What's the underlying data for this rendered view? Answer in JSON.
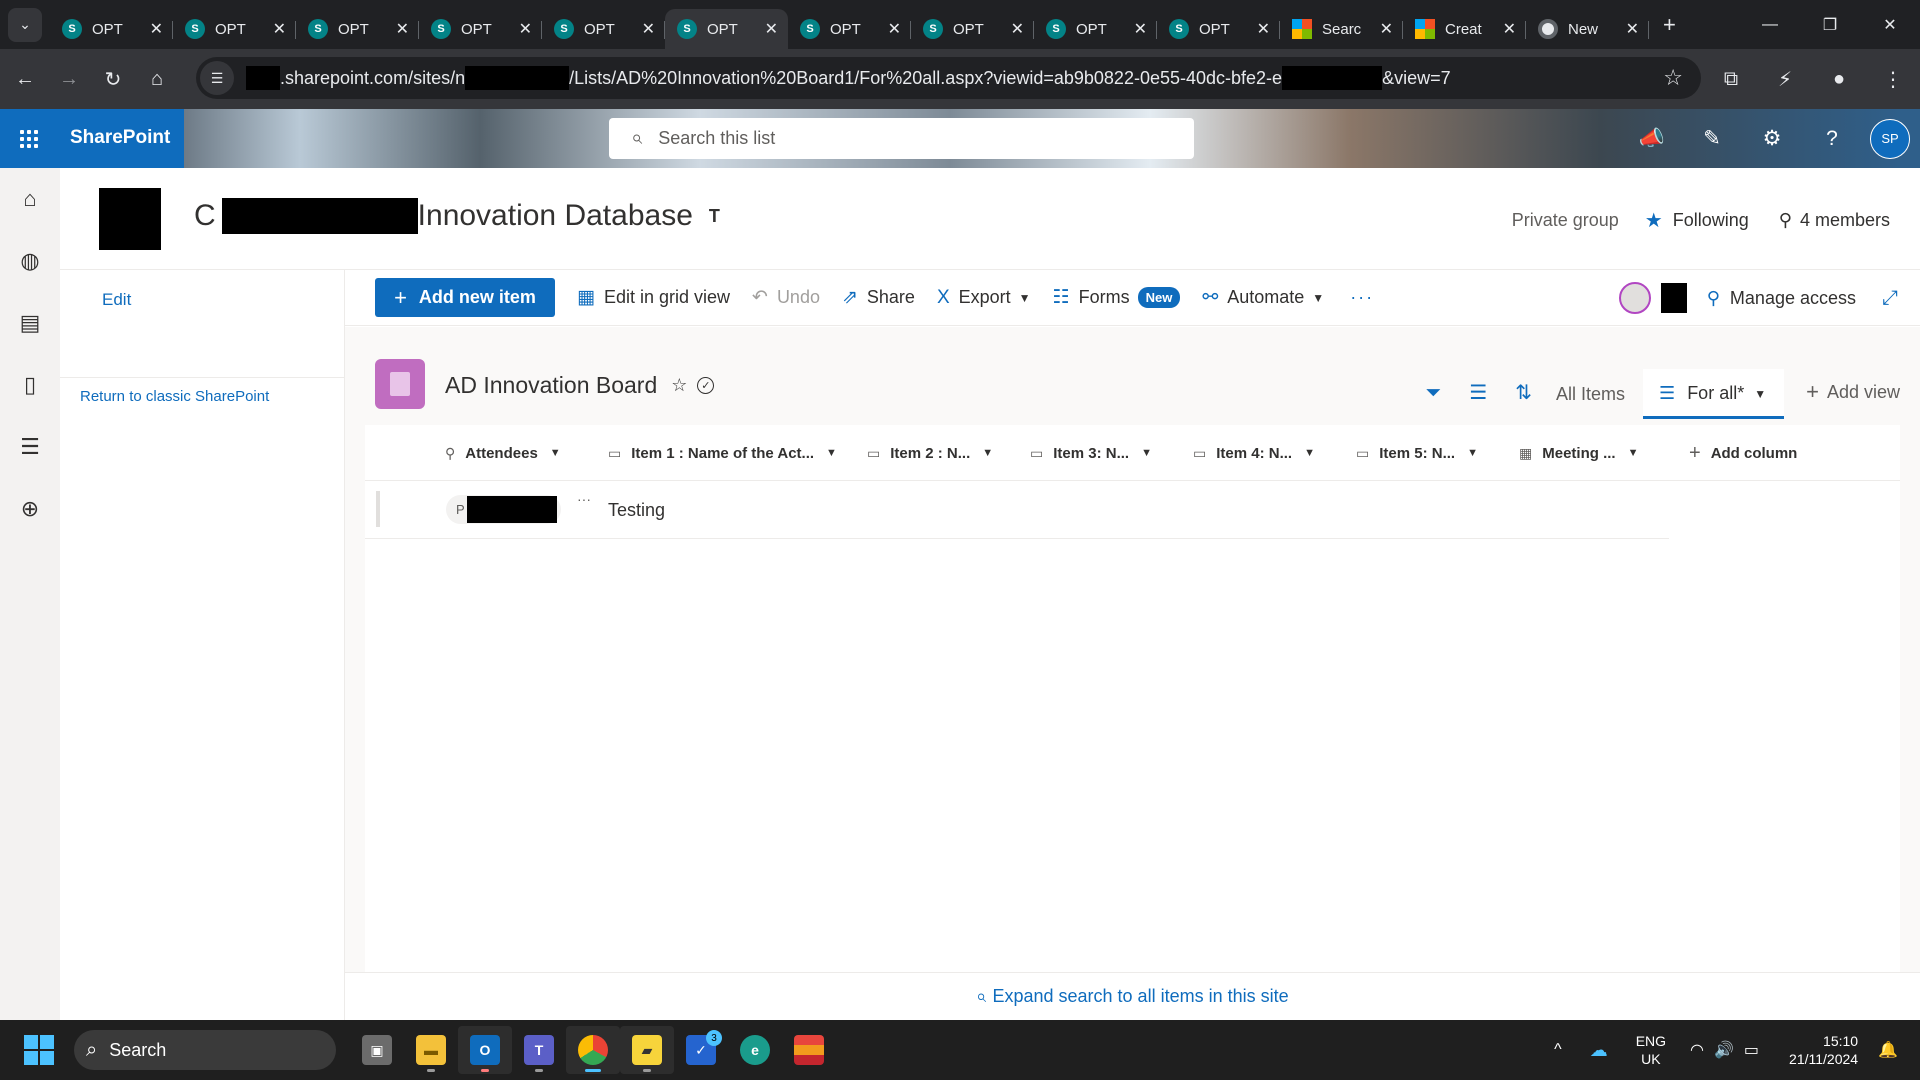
{
  "browser": {
    "tabs": [
      {
        "title": "OPT",
        "icon": "sharepoint-favicon",
        "active": false
      },
      {
        "title": "OPT",
        "icon": "sharepoint-favicon",
        "active": false
      },
      {
        "title": "OPT",
        "icon": "sharepoint-favicon",
        "active": false
      },
      {
        "title": "OPT",
        "icon": "sharepoint-favicon",
        "active": false
      },
      {
        "title": "OPT",
        "icon": "sharepoint-favicon",
        "active": false
      },
      {
        "title": "OPT",
        "icon": "sharepoint-favicon",
        "active": true
      },
      {
        "title": "OPT",
        "icon": "sharepoint-favicon",
        "active": false
      },
      {
        "title": "OPT",
        "icon": "sharepoint-favicon",
        "active": false
      },
      {
        "title": "OPT",
        "icon": "sharepoint-favicon",
        "active": false
      },
      {
        "title": "OPT",
        "icon": "sharepoint-favicon",
        "active": false
      },
      {
        "title": "Searc",
        "icon": "microsoft-favicon",
        "active": false
      },
      {
        "title": "Creat",
        "icon": "microsoft-favicon",
        "active": false
      },
      {
        "title": "New",
        "icon": "chrome-favicon",
        "active": false
      }
    ],
    "url_part1": ".sharepoint.com/sites/n",
    "url_part2": "/Lists/AD%20Innovation%20Board1/For%20all.aspx?viewid=ab9b0822-0e55-40dc-bfe2-e",
    "url_part3": "&view=7"
  },
  "suitebar": {
    "brand": "SharePoint",
    "search_placeholder": "Search this list",
    "user_initials": "SP"
  },
  "site": {
    "title_prefix": "C",
    "title_suffix": "Innovation Database",
    "private_label": "Private group",
    "following_label": "Following",
    "members_label": "4 members"
  },
  "leftnav": {
    "edit_label": "Edit",
    "classic_label": "Return to classic SharePoint"
  },
  "commandbar": {
    "add_new_item": "Add new item",
    "edit_grid": "Edit in grid view",
    "undo": "Undo",
    "share": "Share",
    "export": "Export",
    "forms": "Forms",
    "forms_badge": "New",
    "automate": "Automate",
    "manage_access": "Manage access"
  },
  "list": {
    "title": "AD Innovation Board",
    "views": {
      "all_items": "All Items",
      "current": "For all*",
      "add_view": "Add view"
    },
    "columns": [
      "Attendees",
      "Item 1 : Name of the Act...",
      "Item 2 : N...",
      "Item 3: N...",
      "Item 4: N...",
      "Item 5: N...",
      "Meeting ..."
    ],
    "add_column": "Add column",
    "rows": [
      {
        "attendee_initial": "P",
        "title": "Testing"
      }
    ],
    "expand_search": "Expand search to all items in this site"
  },
  "taskbar": {
    "search_label": "Search",
    "lang_line1": "ENG",
    "lang_line2": "UK",
    "time": "15:10",
    "date": "21/11/2024",
    "todo_badge": "3"
  },
  "colors": {
    "accent": "#0f6cbd",
    "list_icon": "#c06dc0",
    "taskbar": "#1f1f1f"
  }
}
